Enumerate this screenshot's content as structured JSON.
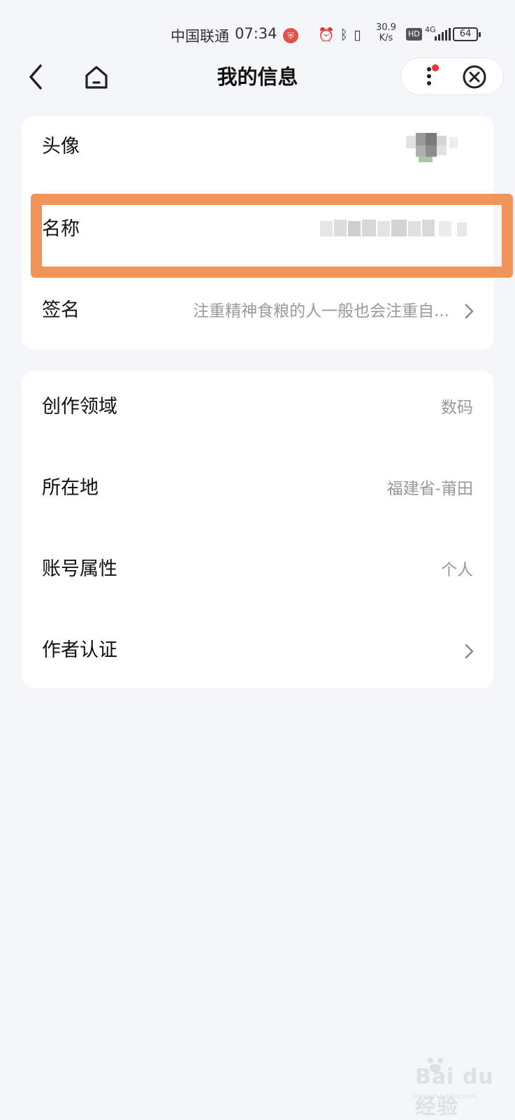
{
  "status_bar": {
    "carrier": "中国联通",
    "time": "07:34",
    "speed_value": "30.9",
    "speed_unit": "K/s",
    "hd": "HD",
    "network": "4G",
    "battery": "64",
    "icons": [
      "alarm-icon",
      "bluetooth-icon",
      "vibrate-icon"
    ]
  },
  "nav": {
    "title": "我的信息",
    "icons": [
      "back-arrow-icon",
      "home-icon",
      "more-icon",
      "close-circle-icon"
    ]
  },
  "card1": {
    "rows": [
      {
        "label": "头像",
        "value": ""
      },
      {
        "label": "名称",
        "value": ""
      },
      {
        "label": "签名",
        "value": "注重精神食粮的人一般也会注重自..."
      }
    ]
  },
  "card2": {
    "rows": [
      {
        "label": "创作领域",
        "value": "数码"
      },
      {
        "label": "所在地",
        "value": "福建省-莆田"
      },
      {
        "label": "账号属性",
        "value": "个人"
      },
      {
        "label": "作者认证",
        "value": ""
      }
    ]
  },
  "watermark": {
    "text": "Bai du 经验",
    "url": "jingyan.baidu.com"
  },
  "colors": {
    "background": "#f4f6f8",
    "card": "#ffffff",
    "highlight": "#f0945a",
    "secondary_text": "#999999",
    "notification_dot": "#f0303a"
  }
}
